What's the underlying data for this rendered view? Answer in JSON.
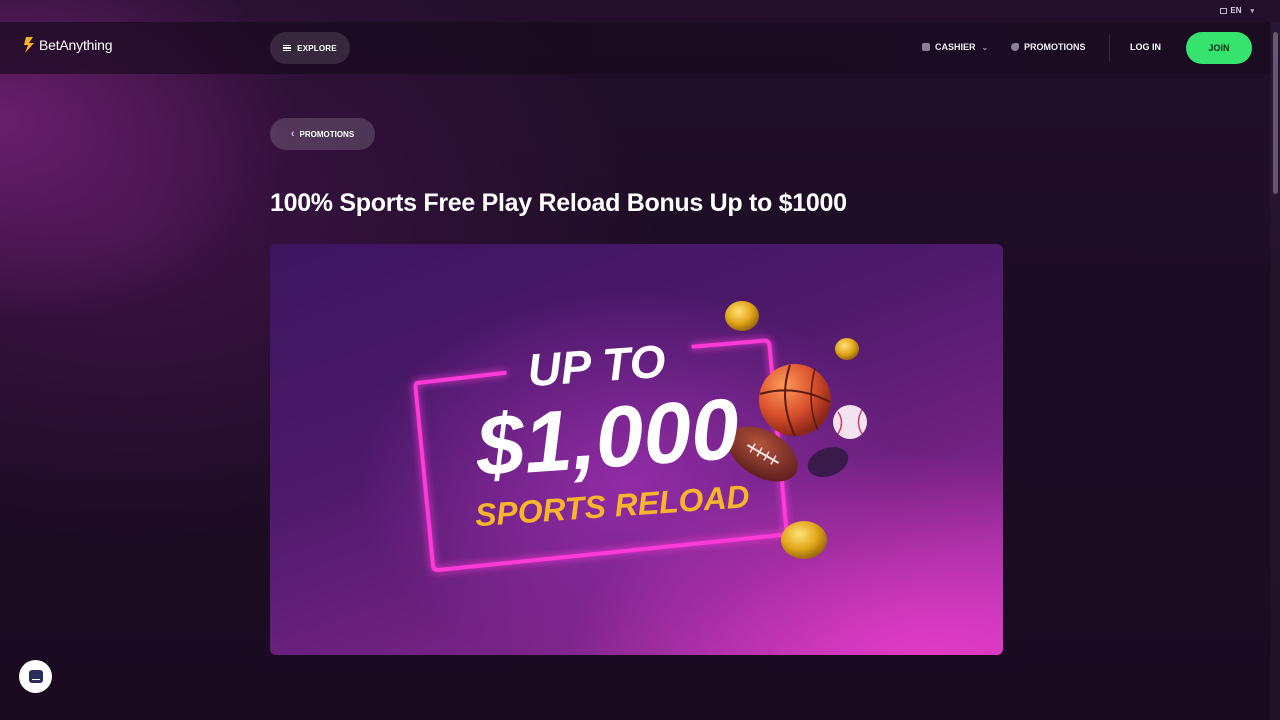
{
  "topbar": {
    "language": "EN"
  },
  "header": {
    "brand": "BetAnything",
    "explore_label": "EXPLORE",
    "cashier_label": "CASHIER",
    "promotions_label": "PROMOTIONS",
    "login_label": "LOG IN",
    "join_label": "JOIN"
  },
  "breadcrumb": {
    "back_label": "PROMOTIONS"
  },
  "page": {
    "title": "100% Sports Free Play Reload Bonus Up to $1000"
  },
  "banner": {
    "line1": "UP TO",
    "line2": "$1,000",
    "line3": "SPORTS RELOAD"
  },
  "colors": {
    "accent_green": "#36e36e",
    "neon_pink": "#ff3ad7",
    "reload_yellow": "#f7b52b",
    "brand_yellow": "#f5b428"
  },
  "icons": [
    "menu-icon",
    "wallet-icon",
    "tag-icon",
    "chevron-down-icon",
    "chevron-left-icon",
    "chat-icon",
    "flag-icon"
  ]
}
